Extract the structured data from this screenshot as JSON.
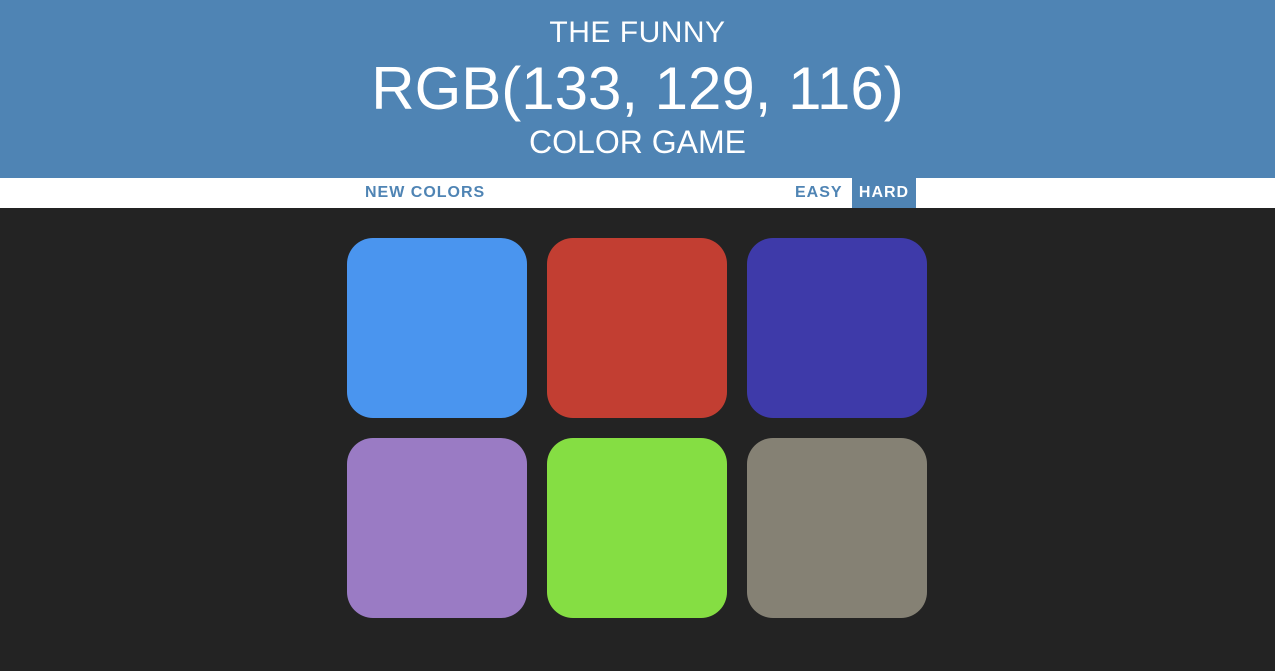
{
  "header": {
    "line1": "THE FUNNY",
    "target_rgb": "RGB(133, 129, 116)",
    "line3": "COLOR GAME",
    "background_color": "#4f84b4"
  },
  "controls": {
    "new_colors_label": "NEW COLORS",
    "easy_label": "EASY",
    "hard_label": "HARD",
    "selected_mode": "HARD"
  },
  "squares": [
    {
      "color": "#4a95ef"
    },
    {
      "color": "#c23e32"
    },
    {
      "color": "#3e3aa9"
    },
    {
      "color": "#9a7bc4"
    },
    {
      "color": "#85de43"
    },
    {
      "color": "#858174"
    }
  ],
  "colors": {
    "board_background": "#232323",
    "accent": "#4f84b4"
  }
}
